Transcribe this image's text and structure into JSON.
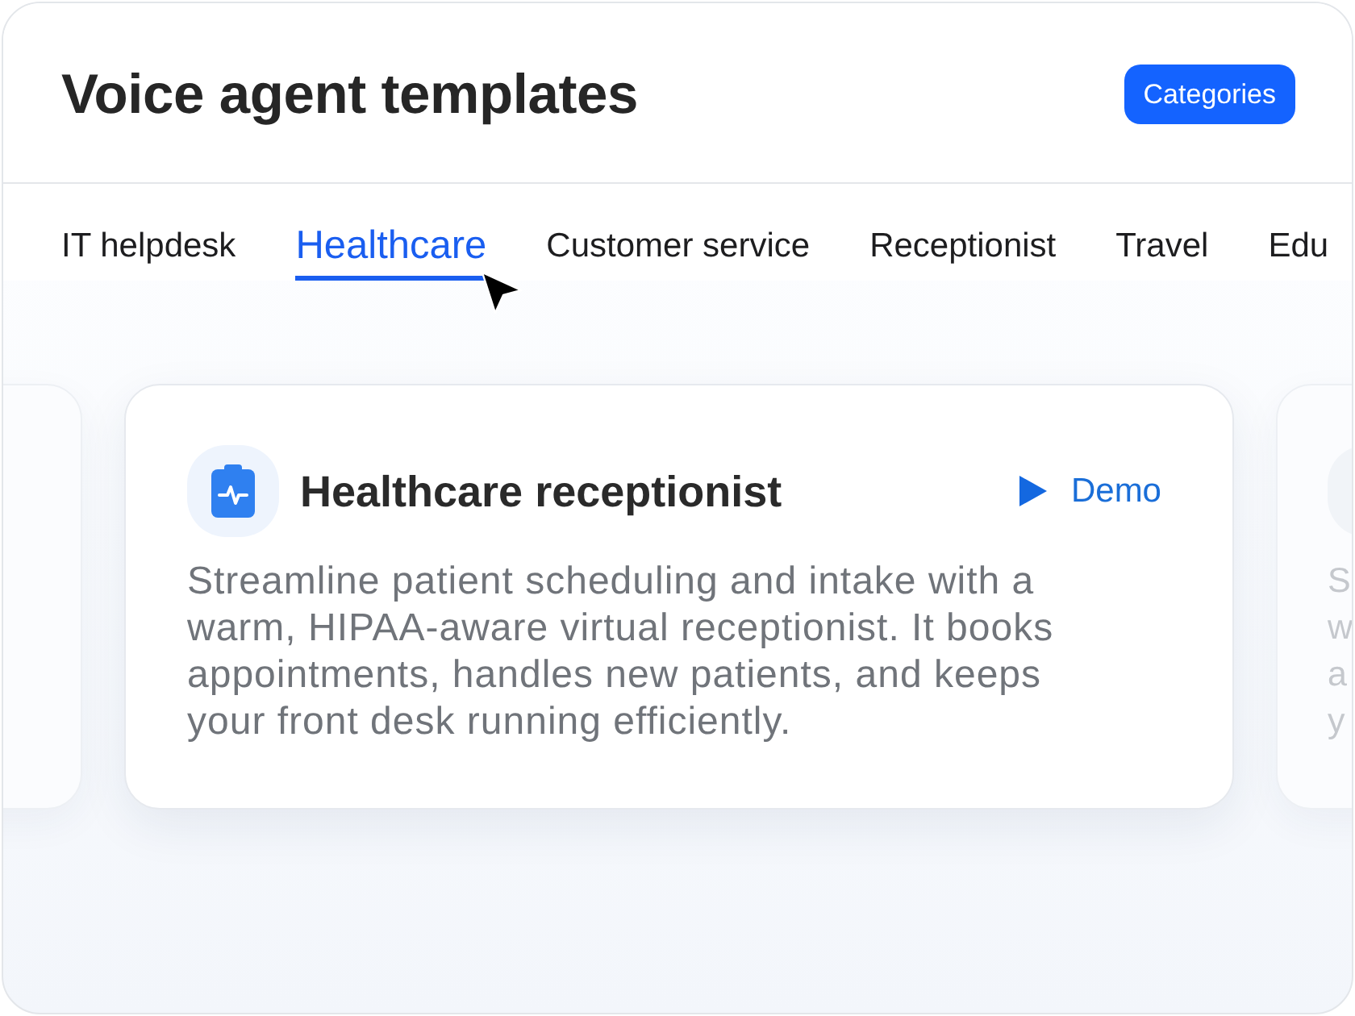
{
  "header": {
    "title": "Voice agent templates",
    "button": "Categories"
  },
  "tabs": [
    {
      "label": "IT helpdesk",
      "selected": false
    },
    {
      "label": "Healthcare",
      "selected": true
    },
    {
      "label": "Customer service",
      "selected": false
    },
    {
      "label": "Receptionist",
      "selected": false
    },
    {
      "label": "Travel",
      "selected": false
    },
    {
      "label": "Edu",
      "selected": false
    }
  ],
  "featured_card": {
    "title": "Healthcare receptionist",
    "demo_label": "Demo",
    "description": "Streamline patient scheduling and intake with a warm, HIPAA-aware virtual receptionist. It books appointments, handles new patients, and keeps your front desk running efficiently."
  },
  "next_card": {
    "description_lines": [
      "S",
      "w",
      "a",
      "y"
    ]
  }
}
